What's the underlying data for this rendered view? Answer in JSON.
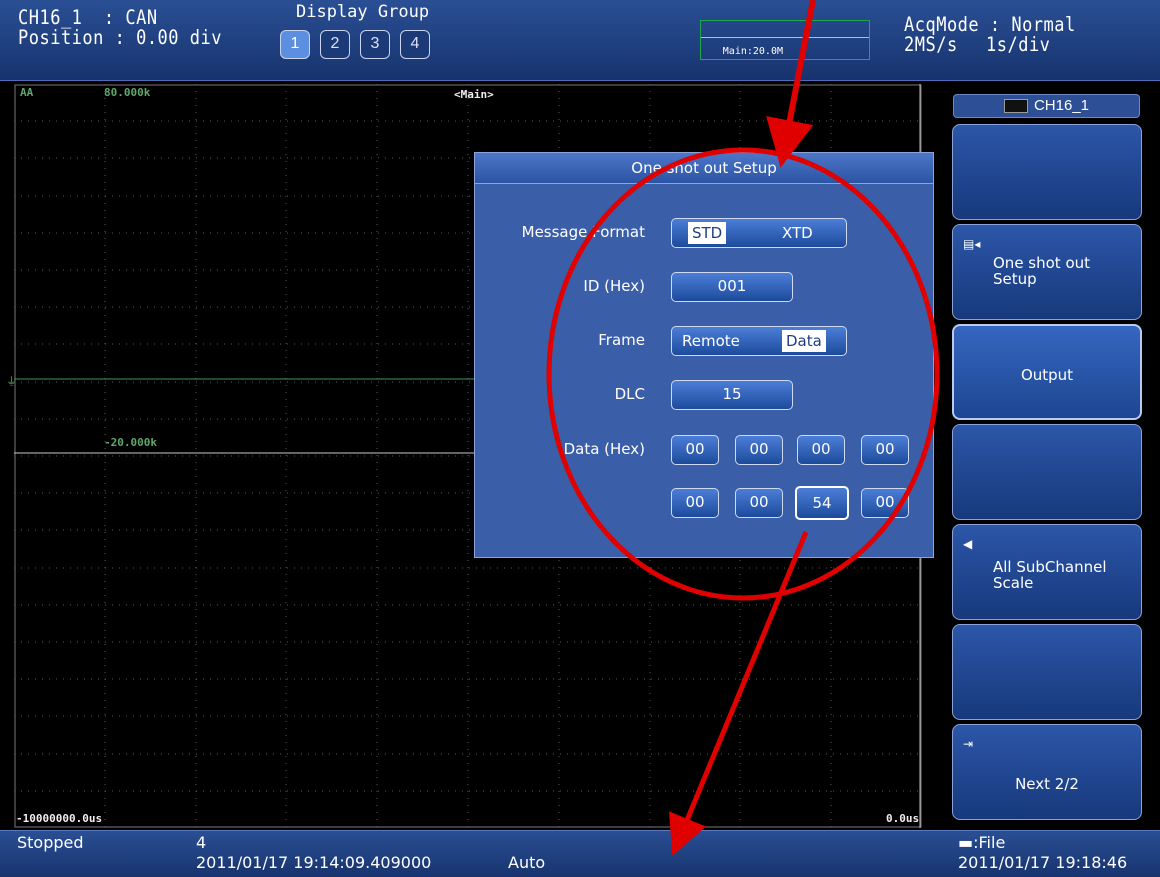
{
  "header": {
    "channel_line": "CH16_1  : CAN",
    "position_line": "Position : 0.00 div",
    "display_group_title": "Display Group",
    "display_groups": [
      "1",
      "2",
      "3",
      "4"
    ],
    "minimap_label": "Main:20.0M",
    "acq_mode": "AcqMode : Normal",
    "sample_rate": "2MS/s",
    "time_div": "1s/div"
  },
  "plot": {
    "trace_name": "AA",
    "y_top": "80.000k",
    "y_mid": "-20.000k",
    "main_label": "<Main>",
    "x_left": "-10000000.0us",
    "x_right": "0.0us"
  },
  "menu": {
    "header_label": "CH16_1",
    "soft1_label": "",
    "soft2_label": "One shot out\nSetup",
    "soft3_label": "Output",
    "soft4_label": "",
    "soft5_label": "All SubChannel\nScale",
    "soft6_label": "",
    "soft7_label": "Next 2/2"
  },
  "dialog": {
    "title": "One shot out Setup",
    "message_format_label": "Message Format",
    "message_format_options": [
      "STD",
      "XTD"
    ],
    "message_format_selected": "STD",
    "id_label": "ID (Hex)",
    "id_value": "001",
    "frame_label": "Frame",
    "frame_options": [
      "Remote",
      "Data"
    ],
    "frame_selected": "Data",
    "dlc_label": "DLC",
    "dlc_value": "15",
    "data_label": "Data (Hex)",
    "data_bytes": [
      "00",
      "00",
      "00",
      "00",
      "00",
      "00",
      "54",
      "00"
    ]
  },
  "status": {
    "state": "Stopped",
    "count": "4",
    "trigger_time": "2011/01/17 19:14:09.409000",
    "mode": "Auto",
    "save_target": ":File",
    "clock": "2011/01/17 19:18:46"
  },
  "colors": {
    "background": "#000000",
    "panel_blue": "#2a4f94",
    "grid": "#6b6b6b",
    "trace_green": "#5fa66a",
    "annotation_red": "#e00000"
  }
}
